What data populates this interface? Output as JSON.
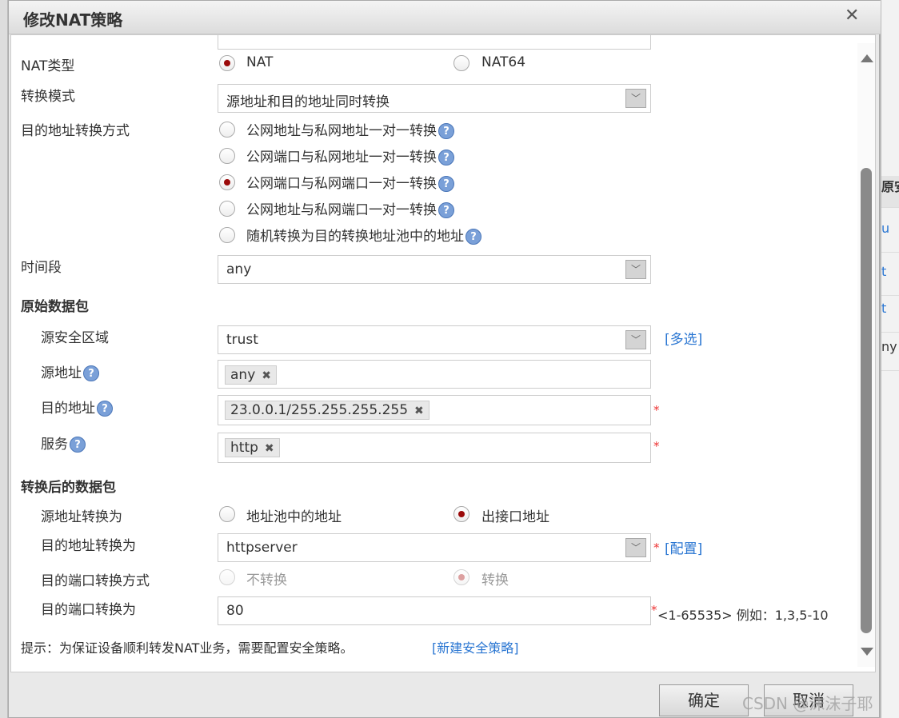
{
  "background": {
    "header_fragment": "原安",
    "rows": [
      "u",
      "t",
      "t"
    ],
    "any_fragment": "ny"
  },
  "dialog": {
    "title": "修改NAT策略",
    "close_icon": "close-icon"
  },
  "form": {
    "nat_type": {
      "label": "NAT类型",
      "options": [
        {
          "label": "NAT",
          "selected": true
        },
        {
          "label": "NAT64",
          "selected": false
        }
      ]
    },
    "mode": {
      "label": "转换模式",
      "value": "源地址和目的地址同时转换"
    },
    "dest_method": {
      "label": "目的地址转换方式",
      "options": [
        {
          "label": "公网地址与私网地址一对一转换",
          "selected": false
        },
        {
          "label": "公网端口与私网地址一对一转换",
          "selected": false
        },
        {
          "label": "公网端口与私网端口一对一转换",
          "selected": true
        },
        {
          "label": "公网地址与私网端口一对一转换",
          "selected": false
        },
        {
          "label": "随机转换为目的转换地址池中的地址",
          "selected": false
        }
      ]
    },
    "time": {
      "label": "时间段",
      "value": "any"
    },
    "original_section": "原始数据包",
    "src_zone": {
      "label": "源安全区域",
      "value": "trust",
      "link": "[多选]"
    },
    "src_addr": {
      "label": "源地址",
      "tags": [
        "any"
      ]
    },
    "dst_addr": {
      "label": "目的地址",
      "tags": [
        "23.0.0.1/255.255.255.255"
      ],
      "required": "*"
    },
    "service": {
      "label": "服务",
      "tags": [
        "http"
      ],
      "required": "*"
    },
    "translated_section": "转换后的数据包",
    "src_trans": {
      "label": "源地址转换为",
      "options": [
        {
          "label": "地址池中的地址",
          "selected": false
        },
        {
          "label": "出接口地址",
          "selected": true
        }
      ]
    },
    "dst_trans": {
      "label": "目的地址转换为",
      "value": "httpserver",
      "required": "*",
      "link": "[配置]"
    },
    "port_method": {
      "label": "目的端口转换方式",
      "options": [
        {
          "label": "不转换",
          "selected": false
        },
        {
          "label": "转换",
          "selected": true
        }
      ]
    },
    "port_trans": {
      "label": "目的端口转换为",
      "value": "80",
      "required": "*",
      "hint": "<1-65535> 例如：1,3,5-10"
    },
    "tip": {
      "text": "提示：为保证设备顺利转发NAT业务，需要配置安全策略。",
      "link": "[新建安全策略]"
    }
  },
  "footer": {
    "ok": "确定",
    "cancel": "取消"
  },
  "watermark": "CSDN @沫沫子耶",
  "colors": {
    "link": "#2a76d2",
    "radio_selected": "#9b0a0a",
    "required": "#e33"
  }
}
